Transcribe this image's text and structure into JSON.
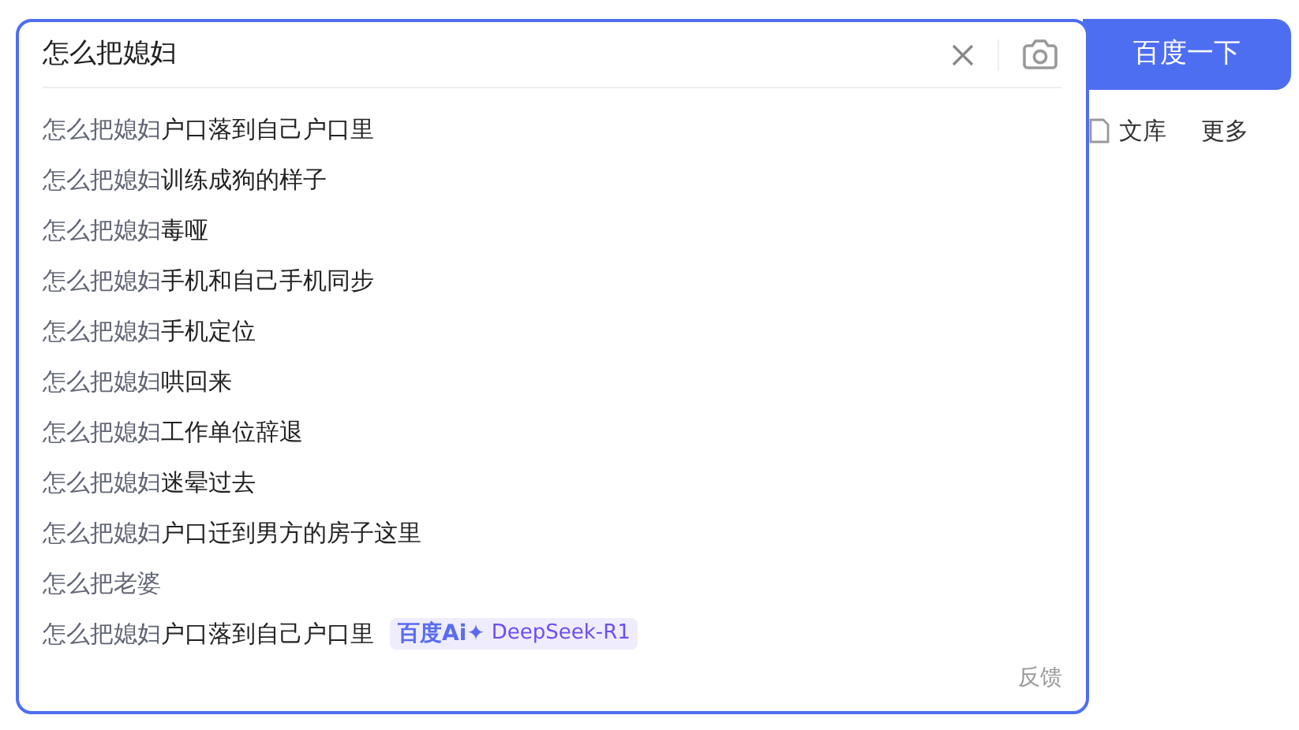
{
  "search": {
    "value": "怎么把媳妇",
    "button": "百度一下"
  },
  "background_links": [
    {
      "label": "文库",
      "icon": true
    },
    {
      "label": "更多",
      "icon": false
    }
  ],
  "suggestions": [
    {
      "prefix": "怎么把媳妇",
      "rest": "户口落到自己户口里"
    },
    {
      "prefix": "怎么把媳妇",
      "rest": "训练成狗的样子"
    },
    {
      "prefix": "怎么把媳妇",
      "rest": "毒哑"
    },
    {
      "prefix": "怎么把媳妇",
      "rest": "手机和自己手机同步"
    },
    {
      "prefix": "怎么把媳妇",
      "rest": "手机定位"
    },
    {
      "prefix": "怎么把媳妇",
      "rest": "哄回来"
    },
    {
      "prefix": "怎么把媳妇",
      "rest": "工作单位辞退"
    },
    {
      "prefix": "怎么把媳妇",
      "rest": "迷晕过去"
    },
    {
      "prefix": "怎么把媳妇",
      "rest": "户口迁到男方的房子这里"
    },
    {
      "prefix": "怎么把老婆"
    },
    {
      "prefix": "怎么把媳妇",
      "rest": "户口落到自己户口里",
      "badge": {
        "logo": "百度Ai✦",
        "model": "DeepSeek-R1"
      }
    }
  ],
  "feedback": "反馈"
}
